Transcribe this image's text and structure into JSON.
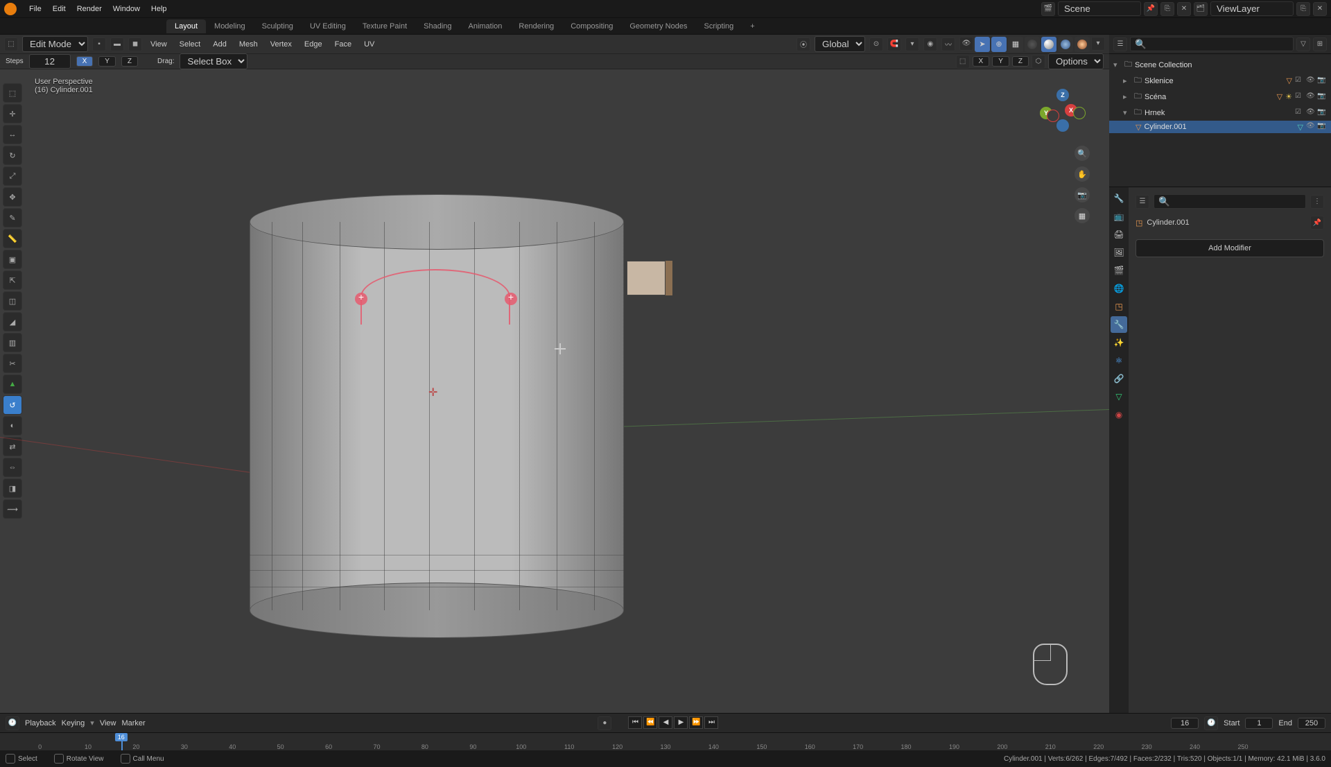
{
  "top_menu": [
    "File",
    "Edit",
    "Render",
    "Window",
    "Help"
  ],
  "workspaces": [
    "Layout",
    "Modeling",
    "Sculpting",
    "UV Editing",
    "Texture Paint",
    "Shading",
    "Animation",
    "Rendering",
    "Compositing",
    "Geometry Nodes",
    "Scripting"
  ],
  "active_workspace": "Layout",
  "scene_name": "Scene",
  "view_layer": "ViewLayer",
  "mode": "Edit Mode",
  "vp_menus": [
    "View",
    "Select",
    "Add",
    "Mesh",
    "Vertex",
    "Edge",
    "Face",
    "UV"
  ],
  "orientation": "Global",
  "steps_label": "Steps",
  "steps_value": "12",
  "axes": [
    "X",
    "Y",
    "Z"
  ],
  "active_axis": "X",
  "drag_label": "Drag:",
  "drag_value": "Select Box",
  "options_label": "Options",
  "vp_info_persp": "User Perspective",
  "vp_info_obj": "(16) Cylinder.001",
  "outliner": {
    "root": "Scene Collection",
    "items": [
      {
        "name": "Sklenice",
        "type": "collection",
        "depth": 1
      },
      {
        "name": "Scéna",
        "type": "collection",
        "depth": 1
      },
      {
        "name": "Hrnek",
        "type": "collection",
        "depth": 1
      },
      {
        "name": "Cylinder.001",
        "type": "mesh",
        "depth": 2,
        "selected": true
      }
    ]
  },
  "props_object_name": "Cylinder.001",
  "add_modifier": "Add Modifier",
  "timeline": {
    "menus": [
      "Playback",
      "Keying",
      "View",
      "Marker"
    ],
    "current": "16",
    "start_label": "Start",
    "start": "1",
    "end_label": "End",
    "end": "250",
    "ticks": [
      0,
      10,
      20,
      30,
      40,
      50,
      60,
      70,
      80,
      90,
      100,
      110,
      120,
      130,
      140,
      150,
      160,
      170,
      180,
      190,
      200,
      210,
      220,
      230,
      240,
      250
    ]
  },
  "status": {
    "left": [
      {
        "icon": "🖱",
        "text": "Select"
      },
      {
        "icon": "🖱",
        "text": "Rotate View"
      },
      {
        "icon": "🖱",
        "text": "Call Menu"
      }
    ],
    "right": "Cylinder.001 | Verts:6/262 | Edges:7/492 | Faces:2/232 | Tris:520 | Objects:1/1 | Memory: 42.1 MiB | 3.6.0"
  }
}
